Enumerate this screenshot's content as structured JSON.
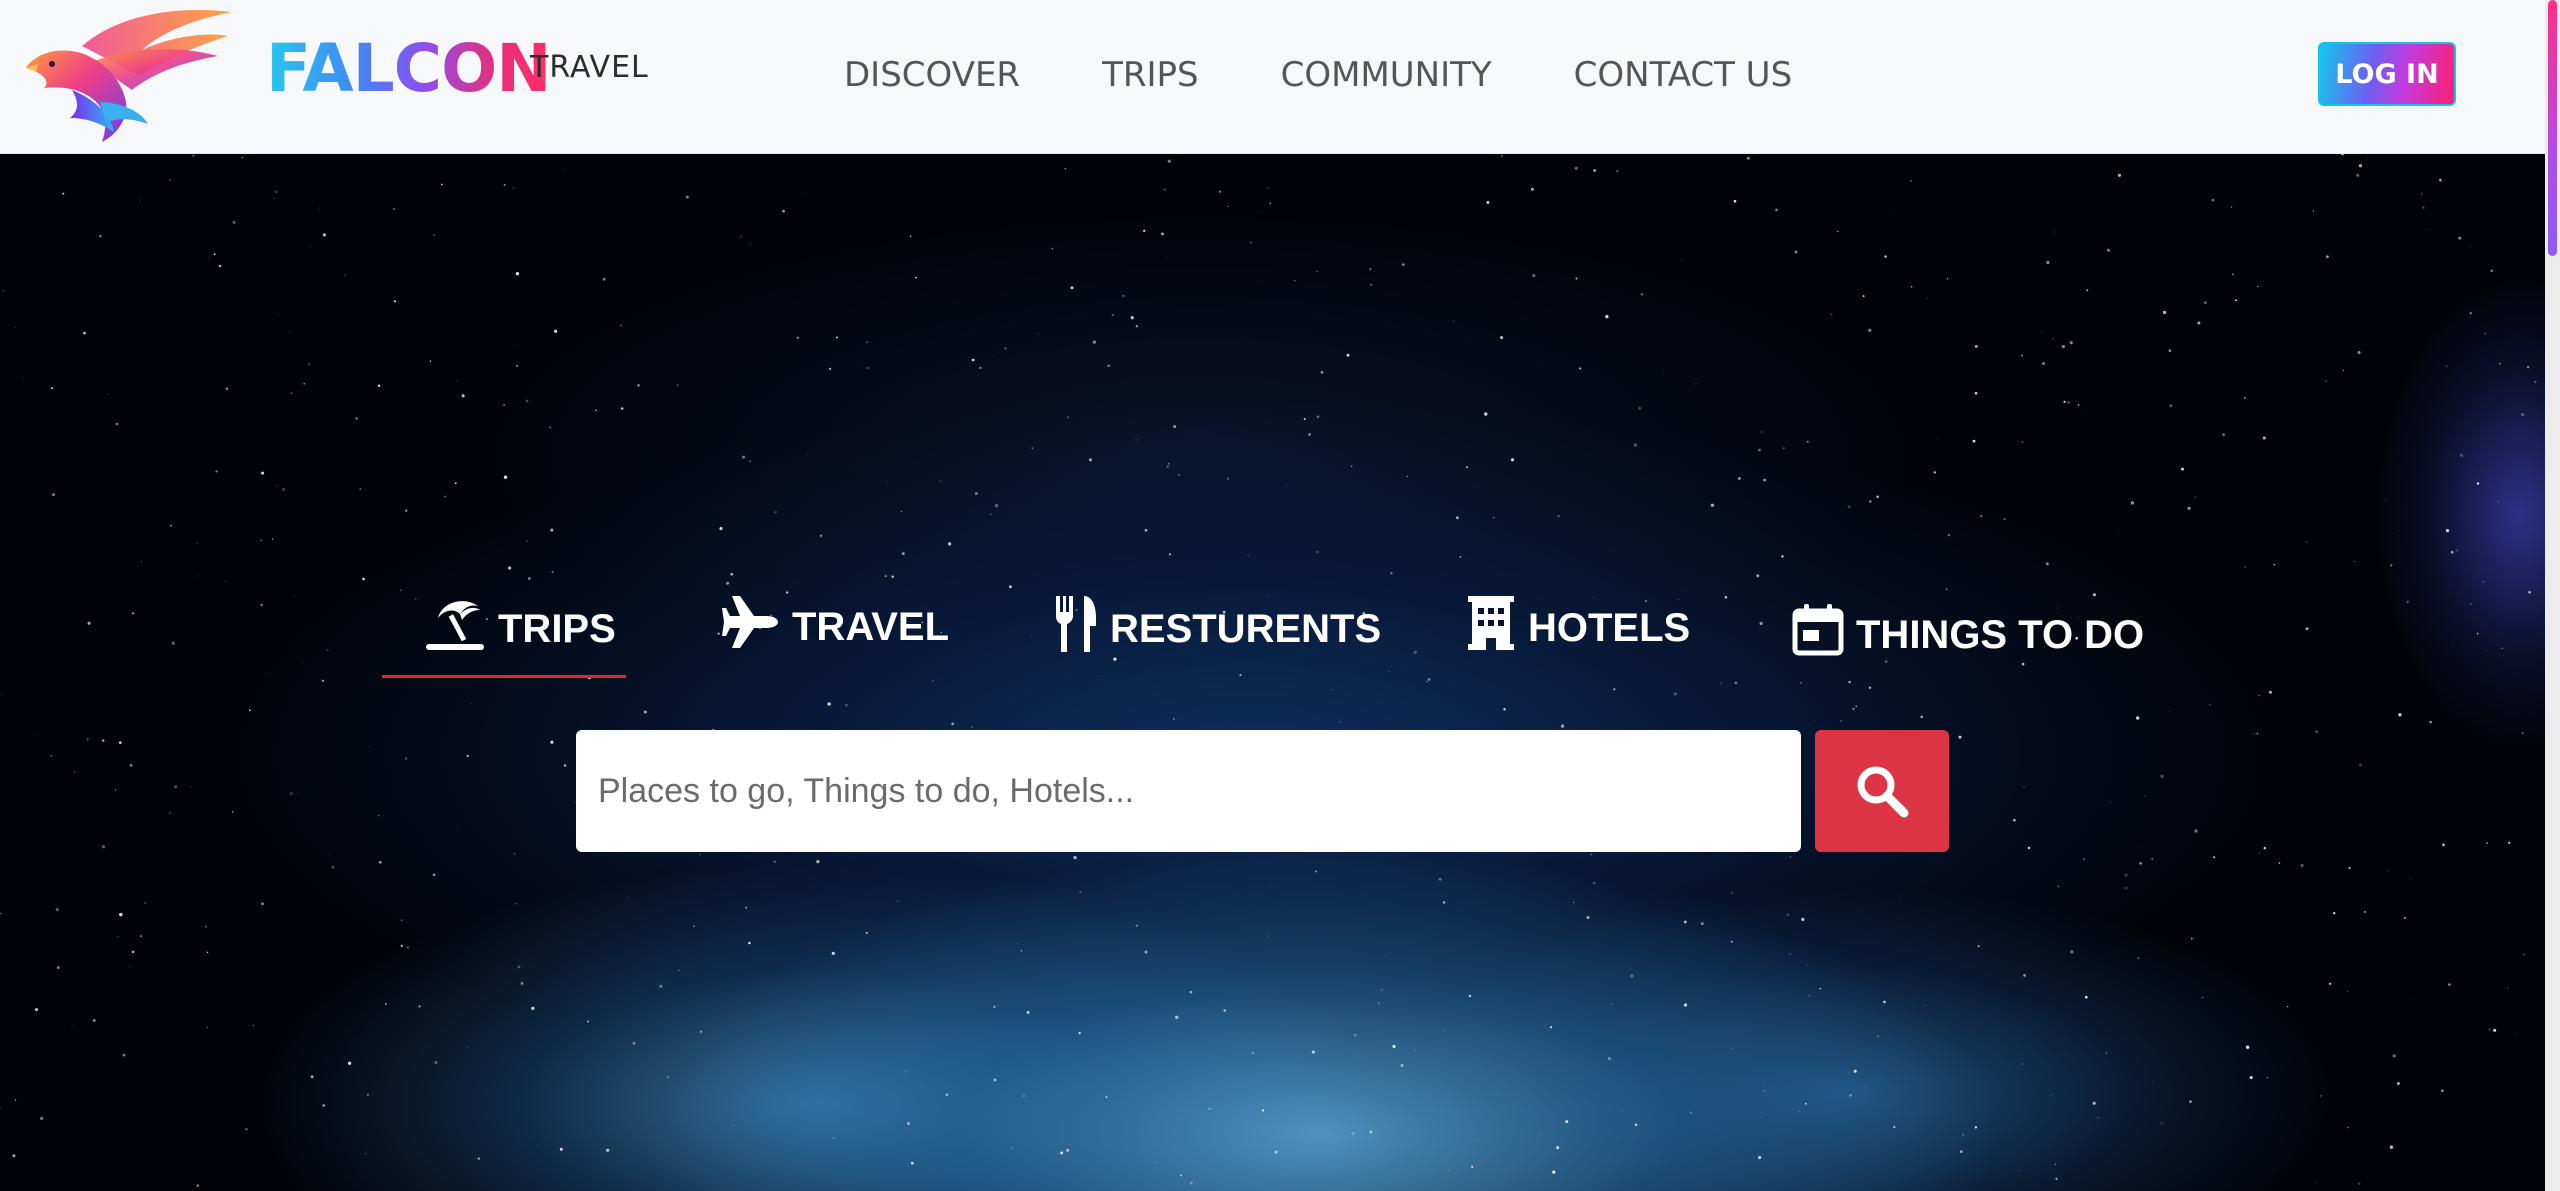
{
  "header": {
    "brand": "FALCON",
    "brand_sub": "TRAVEL",
    "nav": [
      "DISCOVER",
      "TRIPS",
      "COMMUNITY",
      "CONTACT US"
    ],
    "login_label": "LOG IN",
    "logo_icon": "falcon-logo-icon"
  },
  "hero": {
    "tabs": [
      {
        "label": "TRIPS",
        "icon": "beach-umbrella-icon",
        "active": true
      },
      {
        "label": "TRAVEL",
        "icon": "airplane-icon",
        "active": false
      },
      {
        "label": "RESTURENTS",
        "icon": "utensils-icon",
        "active": false
      },
      {
        "label": "HOTELS",
        "icon": "hotel-building-icon",
        "active": false
      },
      {
        "label": "THINGS TO DO",
        "icon": "calendar-icon",
        "active": false
      }
    ],
    "search": {
      "placeholder": "Places to go, Things to do, Hotels...",
      "button_icon": "search-icon"
    }
  },
  "colors": {
    "accent_red": "#dc3545",
    "tab_underline": "#e0262f",
    "nav_text": "#555555",
    "header_bg": "#f7f8fa"
  }
}
